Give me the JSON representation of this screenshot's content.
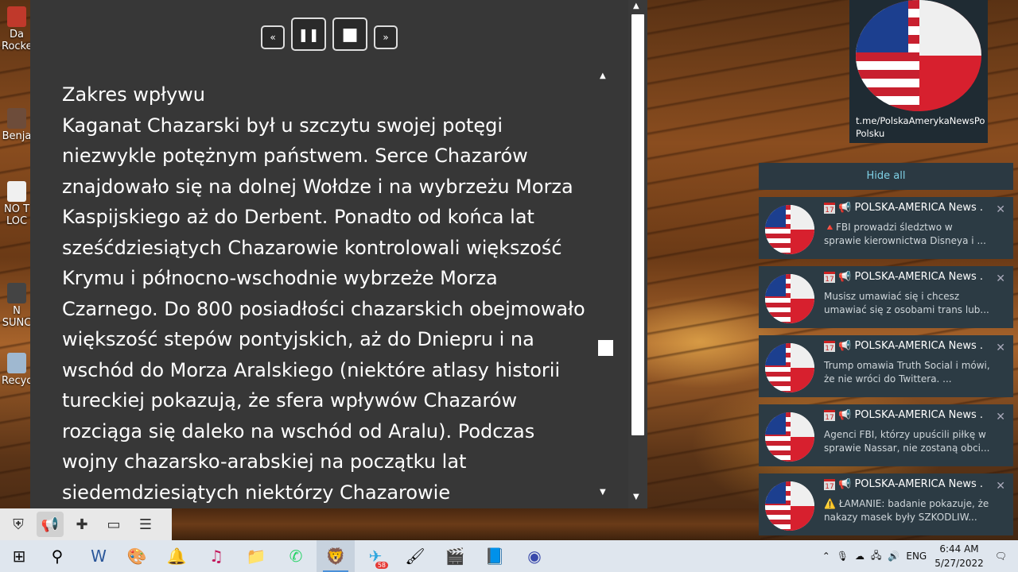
{
  "desktop": {
    "icons": [
      {
        "label": "Da\nRocke"
      },
      {
        "label": "Benja"
      },
      {
        "label": "NO T\nLOC"
      },
      {
        "label": "N\nSUNC"
      },
      {
        "label": "Recyc"
      }
    ]
  },
  "reader": {
    "controls": {
      "rewind": "«",
      "pause": "❚❚",
      "stop": "■",
      "forward": "»"
    },
    "heading": "Zakres wpływu",
    "paragraph": "Kaganat Chazarski był u szczytu swojej potęgi niezwykle potężnym państwem. Serce Chazarów znajdowało się na dolnej Wołdze i na wybrzeżu Morza Kaspijskiego aż do Derbent. Ponadto od końca lat sześćdziesiątych Chazarowie kontrolowali większość Krymu i północno-wschodnie wybrzeże Morza Czarnego. Do 800 posiadłości chazarskich obejmowało większość stepów pontyjskich, aż do Dniepru i na wschód do Morza Aralskiego (niektóre atlasy historii tureckiej pokazują, że sfera wpływów Chazarów rozciąga się daleko na wschód od Aralu). Podczas wojny chazarsko-arabskiej na początku lat siedemdziesiątych niektórzy Chazarowie"
  },
  "telegram_card": {
    "link": "t.me/PolskaAmerykaNewsPo Polsku"
  },
  "notifications": {
    "hide_all": "Hide all",
    "items": [
      {
        "title": "POLSKA-AMERICA News ...",
        "body": "🔺FBI prowadzi śledztwo w sprawie kierownictwa Disneya i ..."
      },
      {
        "title": "POLSKA-AMERICA News ...",
        "body": "Musisz umawiać się i chcesz umawiać się z osobami trans lub..."
      },
      {
        "title": "POLSKA-AMERICA News ...",
        "body": "Trump omawia Truth Social i mówi, że nie wróci do Twittera. ..."
      },
      {
        "title": "POLSKA-AMERICA News ...",
        "body": "Agenci FBI, którzy upuścili piłkę w sprawie Nassar, nie zostaną obci..."
      },
      {
        "title": "POLSKA-AMERICA News ...",
        "body": "⚠️ ŁAMANIE: badanie pokazuje, że nakazy masek były SZKODLIW..."
      }
    ]
  },
  "taskbar": {
    "badge": "58",
    "language": "ENG",
    "time": "6:44 AM",
    "date": "5/27/2022"
  }
}
